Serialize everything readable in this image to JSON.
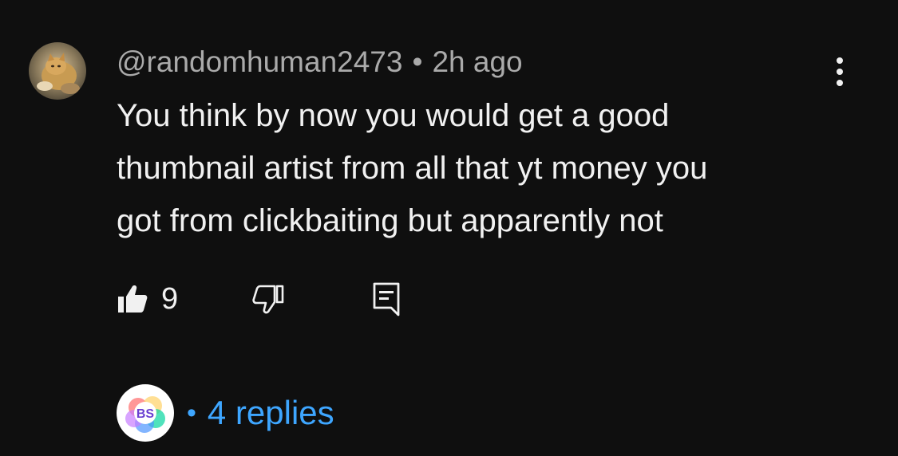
{
  "comment": {
    "author": "@randomhuman2473",
    "separator": "•",
    "time": "2h ago",
    "text": "You think by now you would get a good\nthumbnail artist from all that yt money you\ngot from clickbaiting but apparently not",
    "avatar_icon": "cat-photo-avatar"
  },
  "actions": {
    "like_icon": "thumbs-up-icon",
    "like_count": "9",
    "dislike_icon": "thumbs-down-icon",
    "reply_icon": "reply-comment-icon"
  },
  "menu": {
    "icon": "more-vertical-icon"
  },
  "replies": {
    "creator_avatar_text": "BS",
    "separator": "•",
    "label": "4 replies",
    "color": "#3ea6ff"
  },
  "theme": {
    "background": "#0f0f0f",
    "text_primary": "#f1f1f1",
    "text_secondary": "#aaaaaa",
    "link": "#3ea6ff"
  }
}
